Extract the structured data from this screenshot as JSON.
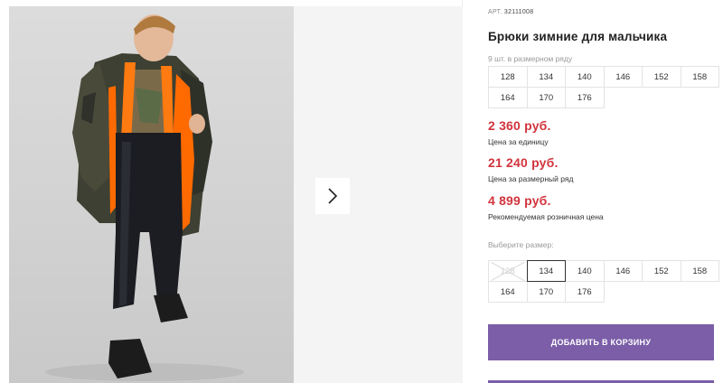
{
  "product": {
    "art_prefix": "АРТ.",
    "art_number": "32111008",
    "title": "Брюки зимние для мальчика"
  },
  "series": {
    "note": "9 шт. в размерном ряду",
    "sizes": [
      "128",
      "134",
      "140",
      "146",
      "152",
      "158",
      "164",
      "170",
      "176"
    ]
  },
  "prices": {
    "unit_price": "2 360 руб.",
    "unit_label": "Цена за единицу",
    "series_price": "21 240 руб.",
    "series_label": "Цена за размерный ряд",
    "retail_price": "4 899 руб.",
    "retail_label": "Рекомендуемая розничная цена"
  },
  "size_select": {
    "label": "Выберите размер:",
    "sizes": [
      "128",
      "134",
      "140",
      "146",
      "152",
      "158",
      "164",
      "170",
      "176"
    ],
    "selected": "134",
    "disabled": [
      "128"
    ]
  },
  "cart": {
    "button_label": "ДОБАВИТЬ В КОРЗИНУ"
  },
  "colors": {
    "price": "#d1343c",
    "accent": "#7b5ea7"
  },
  "icons": {
    "next": "chevron-right-icon"
  }
}
